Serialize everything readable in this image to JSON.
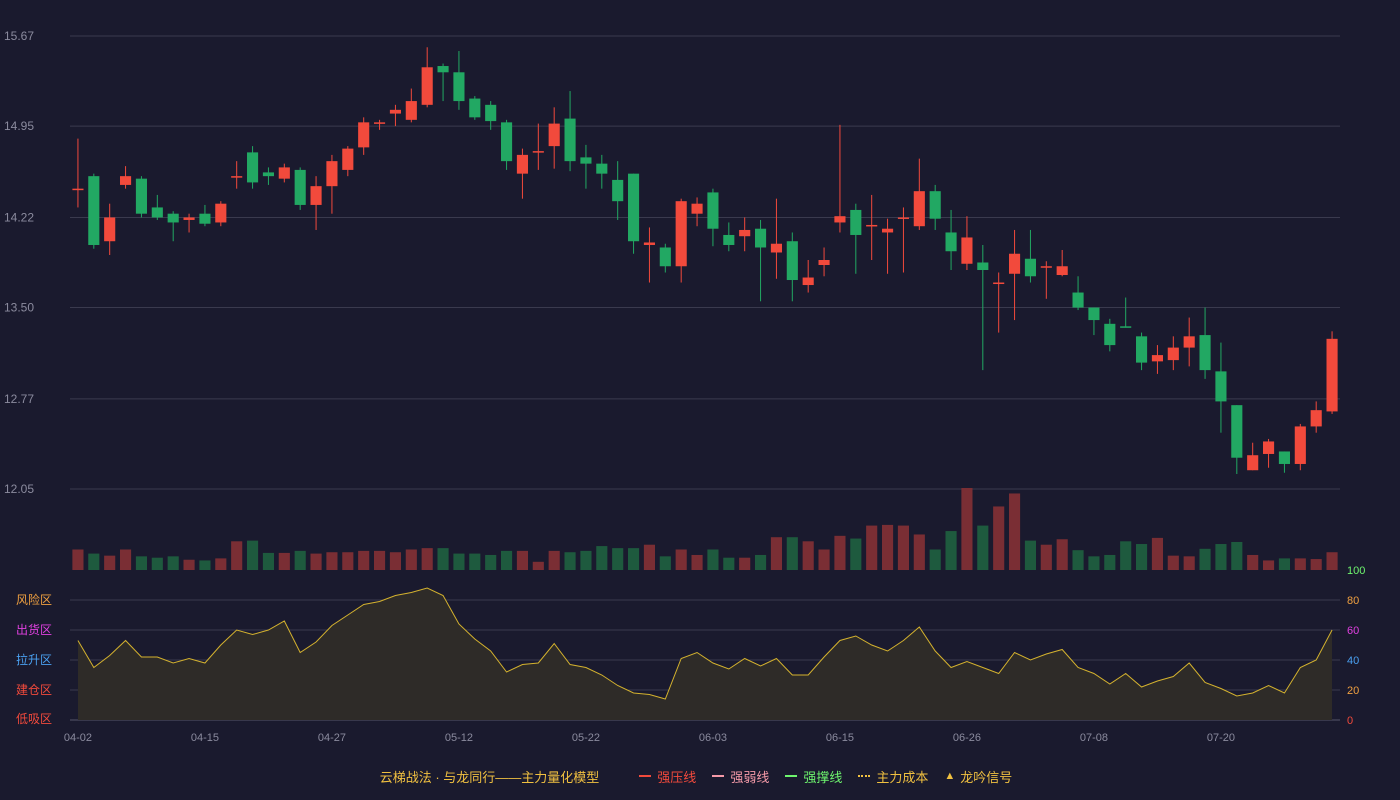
{
  "chart_data": [
    {
      "type": "candlestick",
      "title": "",
      "ylim": [
        11.5,
        15.85
      ],
      "yticks": [
        "15.67",
        "14.95",
        "14.22",
        "13.50",
        "12.77",
        "12.05"
      ],
      "xticks": [
        {
          "index": 0,
          "label": "04-02"
        },
        {
          "index": 8,
          "label": "04-15"
        },
        {
          "index": 16,
          "label": "04-27"
        },
        {
          "index": 24,
          "label": "05-12"
        },
        {
          "index": 32,
          "label": "05-22"
        },
        {
          "index": 40,
          "label": "06-03"
        },
        {
          "index": 48,
          "label": "06-15"
        },
        {
          "index": 56,
          "label": "06-26"
        },
        {
          "index": 64,
          "label": "07-08"
        },
        {
          "index": 72,
          "label": "07-20"
        }
      ],
      "candles": [
        [
          14.45,
          14.45,
          14.85,
          14.3
        ],
        [
          14.55,
          14.0,
          14.57,
          13.97
        ],
        [
          14.03,
          14.22,
          14.33,
          13.92
        ],
        [
          14.48,
          14.55,
          14.63,
          14.45
        ],
        [
          14.53,
          14.25,
          14.55,
          14.22
        ],
        [
          14.3,
          14.22,
          14.4,
          14.2
        ],
        [
          14.25,
          14.18,
          14.27,
          14.03
        ],
        [
          14.2,
          14.22,
          14.25,
          14.1
        ],
        [
          14.25,
          14.17,
          14.32,
          14.15
        ],
        [
          14.18,
          14.33,
          14.35,
          14.15
        ],
        [
          14.55,
          14.55,
          14.67,
          14.45
        ],
        [
          14.74,
          14.5,
          14.79,
          14.45
        ],
        [
          14.58,
          14.55,
          14.62,
          14.48
        ],
        [
          14.53,
          14.62,
          14.65,
          14.5
        ],
        [
          14.6,
          14.32,
          14.62,
          14.28
        ],
        [
          14.32,
          14.47,
          14.55,
          14.12
        ],
        [
          14.47,
          14.67,
          14.72,
          14.25
        ],
        [
          14.6,
          14.77,
          14.79,
          14.55
        ],
        [
          14.78,
          14.98,
          15.02,
          14.72
        ],
        [
          14.97,
          14.98,
          15.0,
          14.92
        ],
        [
          15.05,
          15.08,
          15.12,
          14.95
        ],
        [
          15.0,
          15.15,
          15.25,
          14.98
        ],
        [
          15.12,
          15.42,
          15.58,
          15.1
        ],
        [
          15.43,
          15.38,
          15.45,
          15.15
        ],
        [
          15.38,
          15.15,
          15.55,
          15.08
        ],
        [
          15.17,
          15.02,
          15.19,
          15.0
        ],
        [
          15.12,
          14.99,
          15.15,
          14.92
        ],
        [
          14.98,
          14.67,
          15.0,
          14.6
        ],
        [
          14.57,
          14.72,
          14.77,
          14.37
        ],
        [
          14.75,
          14.75,
          14.97,
          14.6
        ],
        [
          14.79,
          14.97,
          15.1,
          14.61
        ],
        [
          15.01,
          14.67,
          15.23,
          14.59
        ],
        [
          14.7,
          14.65,
          14.8,
          14.45
        ],
        [
          14.65,
          14.57,
          14.72,
          14.45
        ],
        [
          14.52,
          14.35,
          14.67,
          14.2
        ],
        [
          14.57,
          14.03,
          14.57,
          13.93
        ],
        [
          14.0,
          14.02,
          14.14,
          13.7
        ],
        [
          13.98,
          13.83,
          14.01,
          13.78
        ],
        [
          13.83,
          14.35,
          14.37,
          13.7
        ],
        [
          14.25,
          14.33,
          14.38,
          14.15
        ],
        [
          14.42,
          14.13,
          14.45,
          13.99
        ],
        [
          14.08,
          14.0,
          14.18,
          13.95
        ],
        [
          14.07,
          14.12,
          14.22,
          13.95
        ],
        [
          14.13,
          13.98,
          14.2,
          13.55
        ],
        [
          13.94,
          14.01,
          14.37,
          13.73
        ],
        [
          14.03,
          13.72,
          14.1,
          13.55
        ],
        [
          13.68,
          13.74,
          13.88,
          13.62
        ],
        [
          13.84,
          13.88,
          13.98,
          13.75
        ],
        [
          14.18,
          14.23,
          14.96,
          14.1
        ],
        [
          14.28,
          14.08,
          14.33,
          13.77
        ],
        [
          14.15,
          14.16,
          14.4,
          13.88
        ],
        [
          14.1,
          14.13,
          14.21,
          13.77
        ],
        [
          14.22,
          14.22,
          14.3,
          13.78
        ],
        [
          14.15,
          14.43,
          14.69,
          14.12
        ],
        [
          14.43,
          14.21,
          14.48,
          14.12
        ],
        [
          14.1,
          13.95,
          14.28,
          13.8
        ],
        [
          13.85,
          14.06,
          14.23,
          13.8
        ],
        [
          13.86,
          13.8,
          14.0,
          13.0
        ],
        [
          13.7,
          13.7,
          13.78,
          13.3
        ],
        [
          13.77,
          13.93,
          14.12,
          13.4
        ],
        [
          13.89,
          13.75,
          14.12,
          13.7
        ],
        [
          13.83,
          13.83,
          13.87,
          13.57
        ],
        [
          13.76,
          13.83,
          13.96,
          13.75
        ],
        [
          13.62,
          13.5,
          13.75,
          13.48
        ],
        [
          13.5,
          13.4,
          13.5,
          13.28
        ],
        [
          13.37,
          13.2,
          13.41,
          13.15
        ],
        [
          13.35,
          13.34,
          13.58,
          13.34
        ],
        [
          13.27,
          13.06,
          13.3,
          13.0
        ],
        [
          13.07,
          13.12,
          13.2,
          12.97
        ],
        [
          13.08,
          13.18,
          13.27,
          13.0
        ],
        [
          13.18,
          13.27,
          13.42,
          13.03
        ],
        [
          13.28,
          13.0,
          13.5,
          12.93
        ],
        [
          12.99,
          12.75,
          13.22,
          12.5
        ],
        [
          12.72,
          12.3,
          12.72,
          12.17
        ],
        [
          12.2,
          12.32,
          12.42,
          12.2
        ],
        [
          12.33,
          12.43,
          12.45,
          12.22
        ],
        [
          12.35,
          12.25,
          12.35,
          12.18
        ],
        [
          12.25,
          12.55,
          12.57,
          12.2
        ],
        [
          12.55,
          12.68,
          12.75,
          12.5
        ],
        [
          12.67,
          13.25,
          13.31,
          12.65
        ]
      ],
      "volume": {
        "range": [
          0,
          120
        ],
        "values": [
          30,
          24,
          21,
          30,
          20,
          18,
          20,
          15,
          14,
          17,
          42,
          43,
          25,
          25,
          28,
          24,
          26,
          26,
          28,
          28,
          26,
          30,
          32,
          32,
          24,
          24,
          22,
          28,
          28,
          12,
          28,
          26,
          28,
          35,
          32,
          32,
          37,
          20,
          30,
          22,
          30,
          18,
          18,
          22,
          48,
          48,
          42,
          30,
          50,
          46,
          65,
          66,
          65,
          52,
          30,
          57,
          120,
          65,
          93,
          112,
          43,
          37,
          45,
          29,
          20,
          22,
          42,
          38,
          47,
          21,
          20,
          31,
          38,
          41,
          22,
          14,
          17,
          17,
          16,
          26
        ]
      },
      "indicator": {
        "range": [
          0,
          100
        ],
        "yticks": [
          "100",
          "80",
          "60",
          "40",
          "20",
          "0"
        ],
        "zones": [
          "风险区",
          "出货区",
          "拉升区",
          "建仓区",
          "低吸区"
        ],
        "values": [
          53,
          35,
          43,
          53,
          42,
          42,
          38,
          41,
          38,
          50,
          60,
          57,
          60,
          66,
          45,
          52,
          63,
          70,
          77,
          79,
          83,
          85,
          88,
          83,
          64,
          54,
          46,
          32,
          37,
          38,
          51,
          37,
          35,
          30,
          23,
          18,
          17,
          14,
          41,
          45,
          38,
          34,
          41,
          36,
          41,
          30,
          30,
          42,
          53,
          56,
          50,
          46,
          53,
          62,
          46,
          35,
          39,
          35,
          31,
          45,
          40,
          44,
          47,
          35,
          31,
          24,
          31,
          22,
          26,
          29,
          38,
          25,
          21,
          16,
          18,
          23,
          18,
          35,
          40,
          60
        ]
      }
    }
  ],
  "legend": {
    "title": "云梯战法 · 与龙同行——主力量化模型",
    "items": [
      {
        "label": "强压线",
        "color": "#f24a3c"
      },
      {
        "label": "强弱线",
        "color": "#f59aa8"
      },
      {
        "label": "强撑线",
        "color": "#6ef56e"
      },
      {
        "label": "主力成本",
        "color": "#f0c040"
      },
      {
        "label": "龙吟信号",
        "color": "#f0c040"
      }
    ]
  },
  "colors": {
    "up": "#f24a3c",
    "down": "#22a863",
    "vol_up": "#7a2e34",
    "vol_down": "#1e5a3e",
    "indicator_line": "#d4b22e",
    "grid": "#3a3a4e",
    "axis_text": "#8b8b9e",
    "indicator_axis": [
      "#6ef56e",
      "#f0a040",
      "#e040e0",
      "#4aa0f0",
      "#f0a040",
      "#f24a3c"
    ],
    "zone_colors": [
      "#f0a040",
      "#e040e0",
      "#4aa0f0",
      "#f24a3c",
      "#f24a3c"
    ]
  }
}
